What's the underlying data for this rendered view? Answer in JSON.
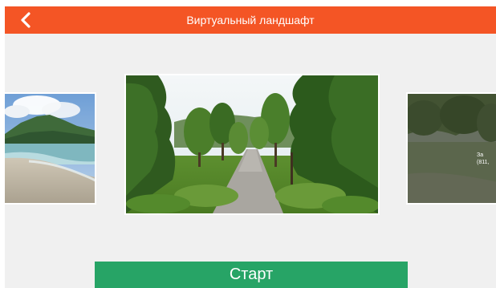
{
  "header": {
    "title": "Виртуальный ландшафт",
    "back_icon": "chevron-left-icon",
    "background_color": "#f45525"
  },
  "carousel": {
    "items": [
      {
        "scene": "beach-with-mountains",
        "caption_line1": "",
        "caption_line2": ""
      },
      {
        "scene": "forest-path",
        "caption_line1": "",
        "caption_line2": ""
      },
      {
        "scene": "meadow-trees",
        "caption_line1": "За",
        "caption_line2": "(811,"
      }
    ]
  },
  "start_button": {
    "label": "Старт",
    "color": "#27a466"
  }
}
